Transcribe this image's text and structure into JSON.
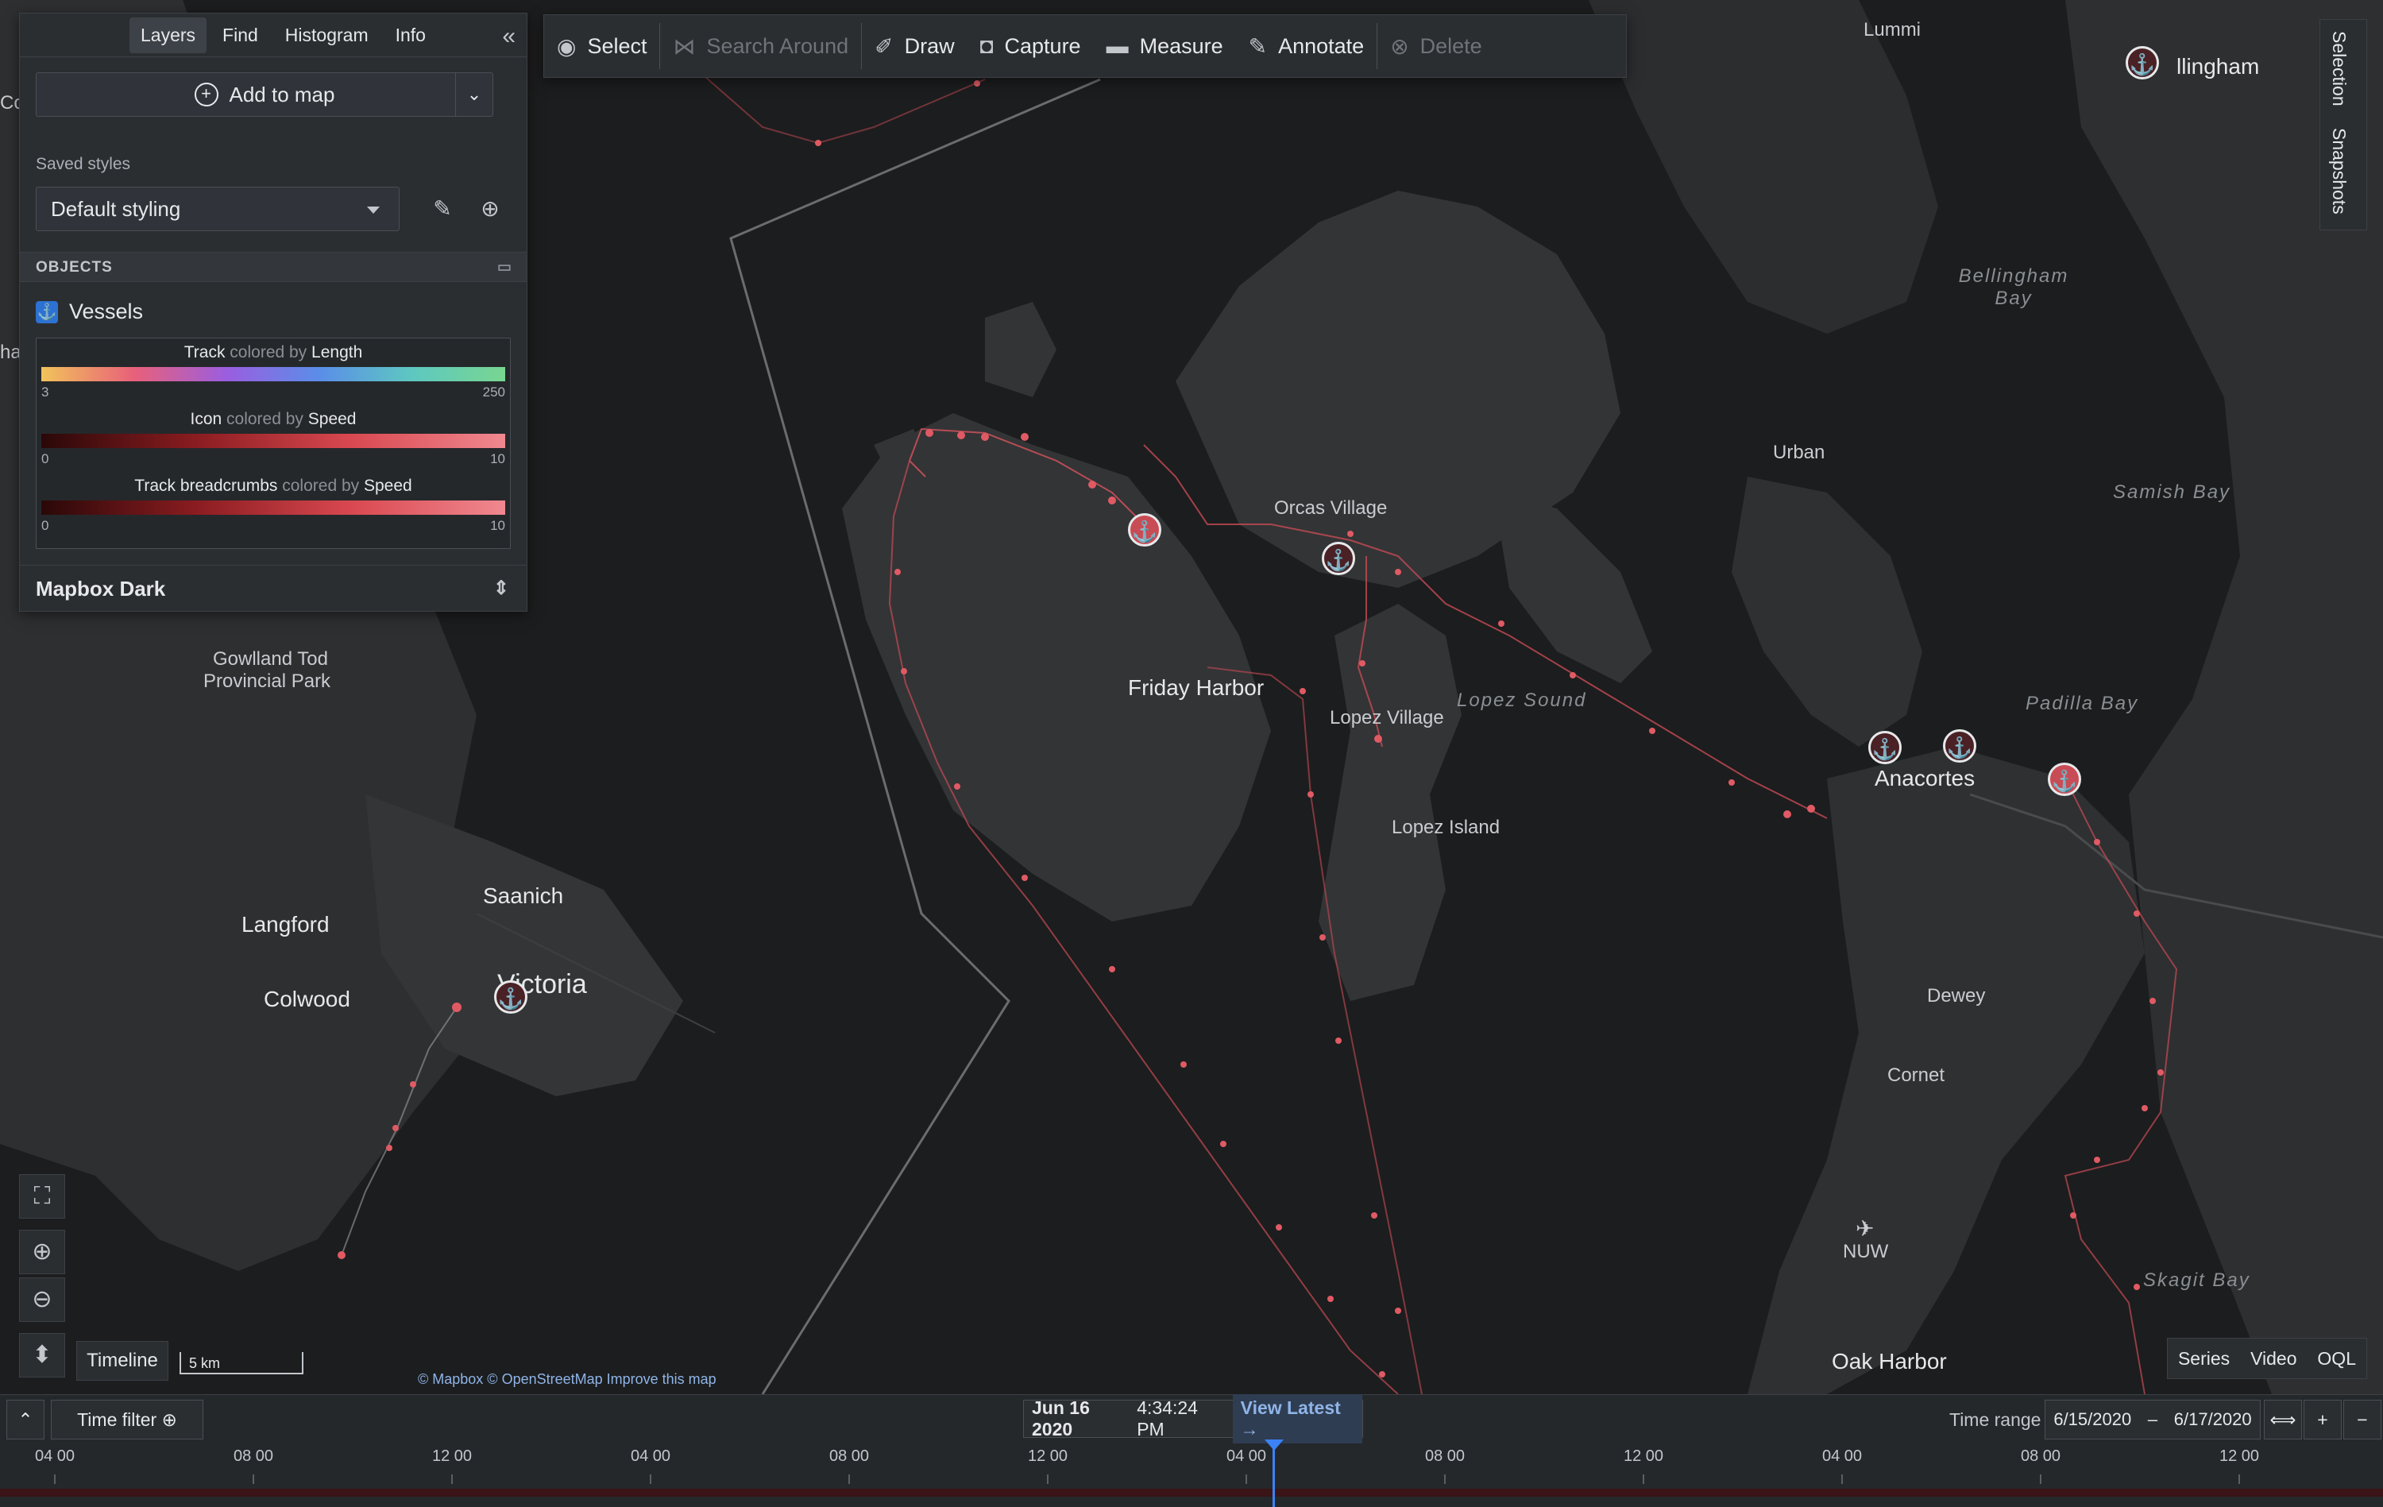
{
  "panel": {
    "tabs": [
      "Layers",
      "Find",
      "Histogram",
      "Info"
    ],
    "add_to_map": "Add to map",
    "saved_styles_label": "Saved styles",
    "saved_style_value": "Default styling",
    "objects_header": "OBJECTS",
    "layer_name": "Vessels",
    "legend": [
      {
        "title_a": "Track",
        "title_dim": "colored by",
        "title_b": "Length",
        "min": "3",
        "max": "250"
      },
      {
        "title_a": "Icon",
        "title_dim": "colored by",
        "title_b": "Speed",
        "min": "0",
        "max": "10"
      },
      {
        "title_a": "Track breadcrumbs",
        "title_dim": "colored by",
        "title_b": "Speed",
        "min": "0",
        "max": "10"
      }
    ],
    "basemap": "Mapbox Dark"
  },
  "toolbar": {
    "select": "Select",
    "search_around": "Search Around",
    "draw": "Draw",
    "capture": "Capture",
    "measure": "Measure",
    "annotate": "Annotate",
    "delete": "Delete"
  },
  "right_tabs": {
    "selection": "Selection",
    "snapshots": "Snapshots"
  },
  "map": {
    "labels": {
      "lummi": "Lummi",
      "bellingham": "llingham",
      "bellingham_bay": "Bellingham Bay",
      "urban": "Urban",
      "samish_bay": "Samish Bay",
      "orcas_village": "Orcas Village",
      "friday_harbor": "Friday Harbor",
      "lopez_village": "Lopez Village",
      "lopez_sound": "Lopez Sound",
      "padilla_bay": "Padilla Bay",
      "anacortes": "Anacortes",
      "lopez_island": "Lopez Island",
      "gowlland": "Gowlland Tod",
      "gowlland2": "Provincial Park",
      "saanich": "Saanich",
      "langford": "Langford",
      "victoria": "Victoria",
      "colwood": "Colwood",
      "dewey": "Dewey",
      "cornet": "Cornet",
      "nuw": "NUW",
      "skagit_bay": "Skagit Bay",
      "oak_harbor": "Oak Harbor",
      "edge_co": "Co",
      "edge_ha": "ha"
    },
    "timeline_button": "Timeline",
    "scale": "5 km",
    "attribution": "© Mapbox © OpenStreetMap Improve this map",
    "series_tabs": [
      "Series",
      "Video",
      "OQL"
    ]
  },
  "bottom": {
    "time_filter": "Time filter",
    "date": "Jun 16 2020",
    "time": "4:34:24 PM",
    "view_latest": "View Latest →",
    "time_range_label": "Time range",
    "range_start": "6/15/2020",
    "range_dash": "–",
    "range_end": "6/17/2020",
    "ticks": [
      "04 00",
      "08 00",
      "12 00",
      "04 00",
      "08 00",
      "12 00",
      "04 00",
      "08 00",
      "12 00",
      "04 00",
      "08 00",
      "12 00"
    ]
  },
  "colors": {
    "accent": "#2d72d2",
    "track": "#e0505a",
    "panel": "#2b2e31"
  }
}
